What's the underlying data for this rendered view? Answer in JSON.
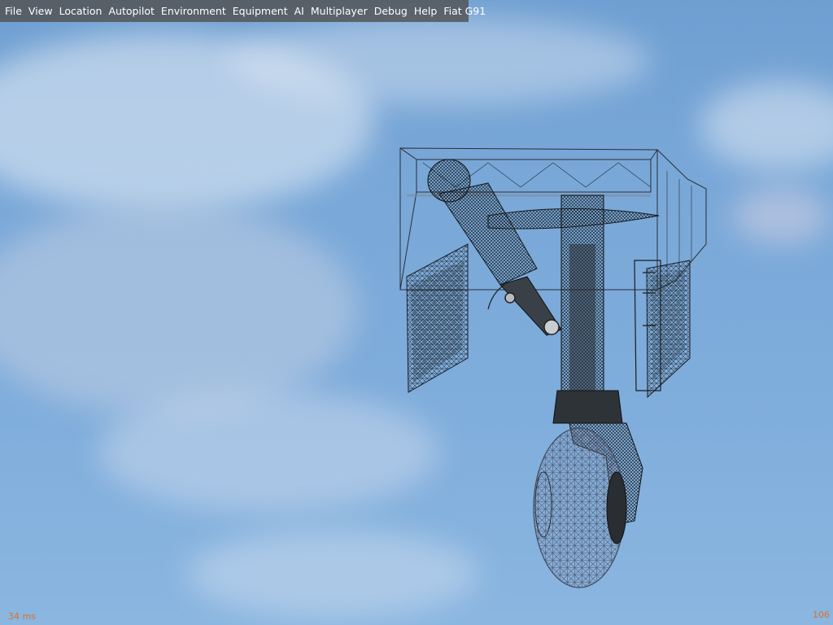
{
  "menubar": {
    "items": [
      "File",
      "View",
      "Location",
      "Autopilot",
      "Environment",
      "Equipment",
      "AI",
      "Multiplayer",
      "Debug",
      "Help",
      "Fiat G91"
    ]
  },
  "hud": {
    "frame_time": "34 ms",
    "fps": "106"
  },
  "scene": {
    "subject": "landing-gear-wireframe"
  },
  "colors": {
    "hud_text": "#e0702a",
    "sky": "#7eacdb",
    "menubar_bg": "#525252"
  }
}
